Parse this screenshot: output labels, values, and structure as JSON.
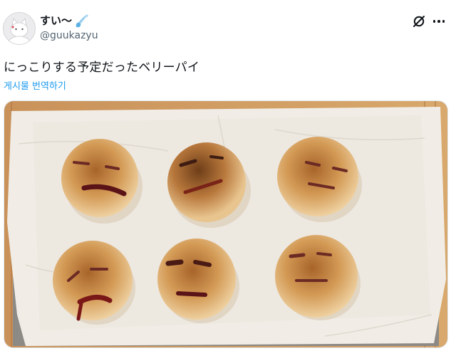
{
  "author": {
    "display_name": "すい〜",
    "handle": "@guukazyu",
    "avatar_icon": "cat-avatar-icon",
    "badge_icon": "comet-emoji-icon"
  },
  "header_actions": [
    {
      "icon": "grok-icon"
    },
    {
      "icon": "more-icon"
    }
  ],
  "post": {
    "text": "にっこりする予定だったベリーパイ",
    "translate_label": "게시물 번역하기"
  },
  "media": {
    "kind": "photo",
    "subject": "six-pies-with-faces",
    "pie_count": 6
  },
  "colors": {
    "text_primary": "#0f1419",
    "text_secondary": "#536471",
    "link": "#1d9bf0"
  }
}
